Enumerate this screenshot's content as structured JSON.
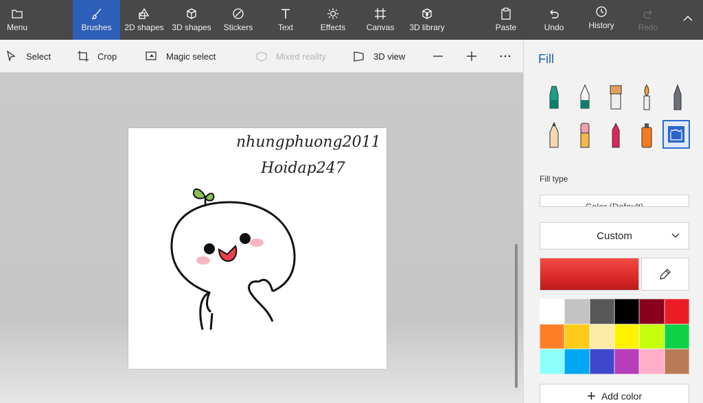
{
  "ribbon": {
    "menu_label": "Menu",
    "brushes_label": "Brushes",
    "shapes2d_label": "2D shapes",
    "shapes3d_label": "3D shapes",
    "stickers_label": "Stickers",
    "text_label": "Text",
    "effects_label": "Effects",
    "canvas_label": "Canvas",
    "library3d_label": "3D library",
    "paste_label": "Paste",
    "undo_label": "Undo",
    "history_label": "History",
    "redo_label": "Redo"
  },
  "toolbar": {
    "select_label": "Select",
    "crop_label": "Crop",
    "magic_select_label": "Magic select",
    "mixed_reality_label": "Mixed reality",
    "view3d_label": "3D view"
  },
  "canvas": {
    "text_line1": "nhungphuong2011",
    "text_line2": "Hoidap247"
  },
  "panel": {
    "title": "Fill",
    "fill_type_label": "Fill type",
    "fill_type_value": "Color (Default)",
    "dropdown_value": "Custom",
    "current_color": "#e53030",
    "add_color_label": "Add color",
    "palette": [
      "#ffffff",
      "#c3c3c3",
      "#585858",
      "#000000",
      "#88001b",
      "#ec1c24",
      "#ff7f27",
      "#ffca18",
      "#fdeca6",
      "#fff200",
      "#c4ff0e",
      "#0ed145",
      "#8cfffb",
      "#00a8f3",
      "#3f48cc",
      "#b83dba",
      "#ffaec8",
      "#b97a56"
    ],
    "brushes": [
      "marker",
      "calligraphy-pen",
      "oil-brush",
      "watercolor",
      "pixel-pen",
      "pencil",
      "eraser",
      "crayon",
      "spray-can",
      "fill-bucket"
    ]
  }
}
